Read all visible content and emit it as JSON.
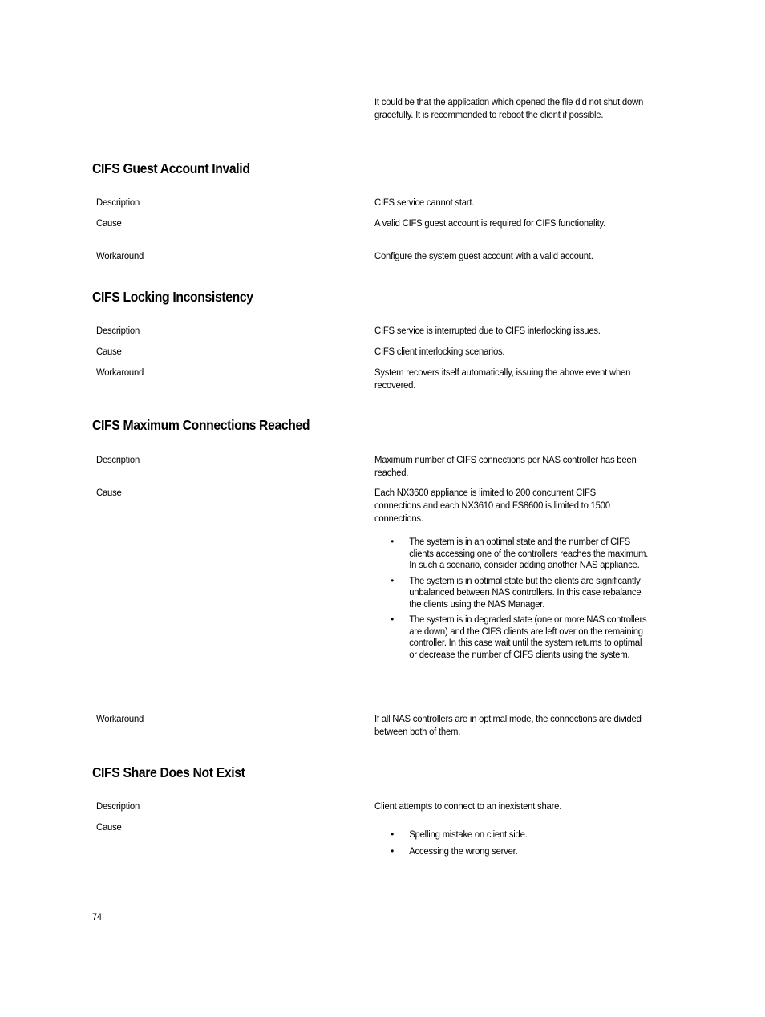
{
  "intro_text": "It could be that the application which opened the file did not shut down gracefully. It is recommended to reboot the client if possible.",
  "sections": [
    {
      "title": "CIFS Guest Account Invalid",
      "rows": [
        {
          "label": "Description",
          "value": "CIFS service cannot start."
        },
        {
          "label": "Cause",
          "value": "A valid CIFS guest account is required for CIFS functionality."
        },
        {
          "label": "Workaround",
          "value": "Configure the system guest account with a valid account."
        }
      ]
    },
    {
      "title": "CIFS Locking Inconsistency",
      "rows": [
        {
          "label": "Description",
          "value": "CIFS service is interrupted due to CIFS interlocking issues."
        },
        {
          "label": "Cause",
          "value": "CIFS client interlocking scenarios."
        },
        {
          "label": "Workaround",
          "value": "System recovers itself automatically, issuing the above event when recovered."
        }
      ]
    },
    {
      "title": "CIFS Maximum Connections Reached",
      "rows": [
        {
          "label": "Description",
          "value": "Maximum number of CIFS connections per NAS controller has been reached."
        },
        {
          "label": "Cause",
          "value": "Each NX3600 appliance is limited to 200 concurrent CIFS connections and each NX3610 and FS8600 is limited to 1500 connections.",
          "bullets": [
            "The system is in an optimal state and the number of CIFS clients accessing one of the controllers reaches the maximum. In such a scenario, consider adding another NAS appliance.",
            "The system is in optimal state but the clients are significantly unbalanced between NAS controllers. In this case rebalance the clients using the NAS Manager.",
            "The system is in degraded state (one or more NAS controllers are down) and the CIFS clients are left over on the remaining controller. In this case wait until the system returns to optimal or decrease the number of CIFS clients using the system."
          ]
        },
        {
          "label": "Workaround",
          "value": "If all NAS controllers are in optimal mode, the connections are divided between both of them."
        }
      ]
    },
    {
      "title": "CIFS Share Does Not Exist",
      "rows": [
        {
          "label": "Description",
          "value": "Client attempts to connect to an inexistent share."
        },
        {
          "label": "Cause",
          "bullets": [
            "Spelling mistake on client side.",
            "Accessing the wrong server."
          ]
        }
      ]
    }
  ],
  "bullet_glyph": "•",
  "page_number": "74"
}
